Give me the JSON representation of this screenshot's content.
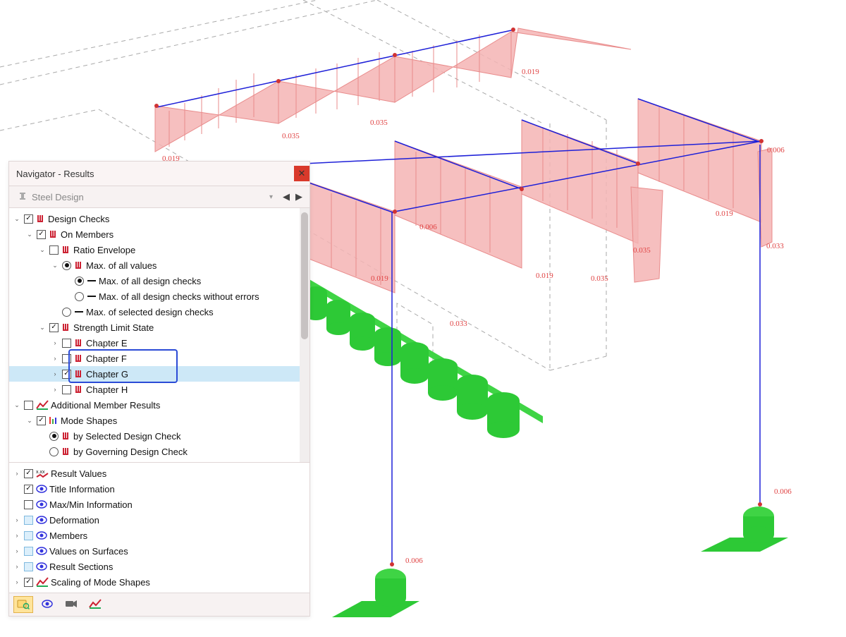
{
  "panel": {
    "title": "Navigator - Results",
    "dropdown": "Steel Design"
  },
  "tree": {
    "design_checks": "Design Checks",
    "on_members": "On Members",
    "ratio_envelope": "Ratio Envelope",
    "max_all_values": "Max. of all values",
    "max_all_checks": "Max. of all design checks",
    "max_all_checks_no_err": "Max. of all design checks without errors",
    "max_selected": "Max. of selected design checks",
    "strength_limit": "Strength Limit State",
    "chapter_e": "Chapter E",
    "chapter_f": "Chapter F",
    "chapter_g": "Chapter G",
    "chapter_h": "Chapter H",
    "additional": "Additional Member Results",
    "mode_shapes": "Mode Shapes",
    "by_selected": "by Selected Design Check",
    "by_governing": "by Governing Design Check"
  },
  "lower": {
    "result_values": "Result Values",
    "title_info": "Title Information",
    "maxmin": "Max/Min Information",
    "deformation": "Deformation",
    "members": "Members",
    "values_surf": "Values on Surfaces",
    "result_sections": "Result Sections",
    "scaling": "Scaling of Mode Shapes"
  },
  "viewport_labels": {
    "v006": "0.006",
    "v019": "0.019",
    "v033": "0.033",
    "v035": "0.035"
  }
}
